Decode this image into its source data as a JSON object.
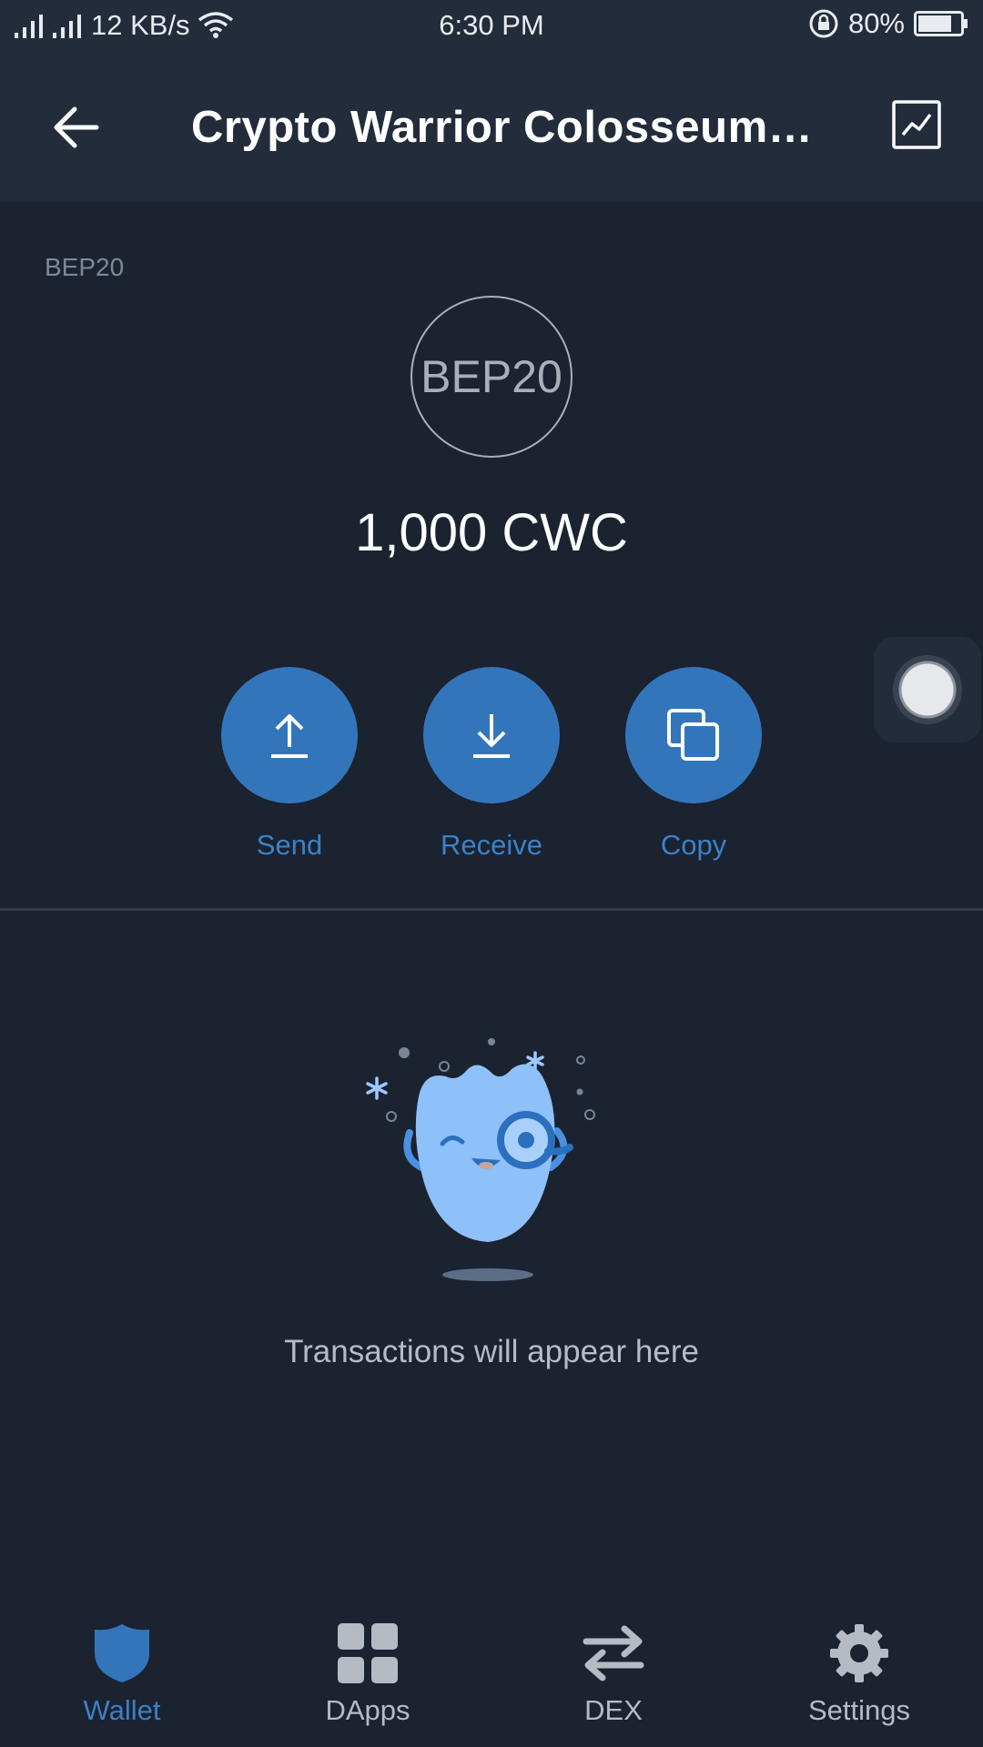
{
  "status_bar": {
    "network_speed": "12 KB/s",
    "time": "6:30 PM",
    "battery": "80%",
    "battery_level": 0.8
  },
  "header": {
    "title": "Crypto Warrior Colosseum…",
    "back_icon": "arrow-left-icon",
    "chart_icon": "price-chart-icon"
  },
  "token": {
    "standard": "BEP20",
    "logo_text": "BEP20",
    "balance": "1,000 CWC"
  },
  "actions": [
    {
      "label": "Send",
      "icon": "upload-arrow-icon"
    },
    {
      "label": "Receive",
      "icon": "download-arrow-icon"
    },
    {
      "label": "Copy",
      "icon": "copy-icon"
    }
  ],
  "transactions": {
    "empty_message": "Transactions will appear here"
  },
  "bottom_nav": [
    {
      "label": "Wallet",
      "icon": "shield-icon",
      "active": true
    },
    {
      "label": "DApps",
      "icon": "grid-icon",
      "active": false
    },
    {
      "label": "DEX",
      "icon": "swap-arrows-icon",
      "active": false
    },
    {
      "label": "Settings",
      "icon": "gear-icon",
      "active": false
    }
  ],
  "colors": {
    "background": "#1b2230",
    "header": "#222c3b",
    "accent": "#3375bb",
    "accent_text": "#3b82c8",
    "muted_text": "#b5bac3"
  }
}
